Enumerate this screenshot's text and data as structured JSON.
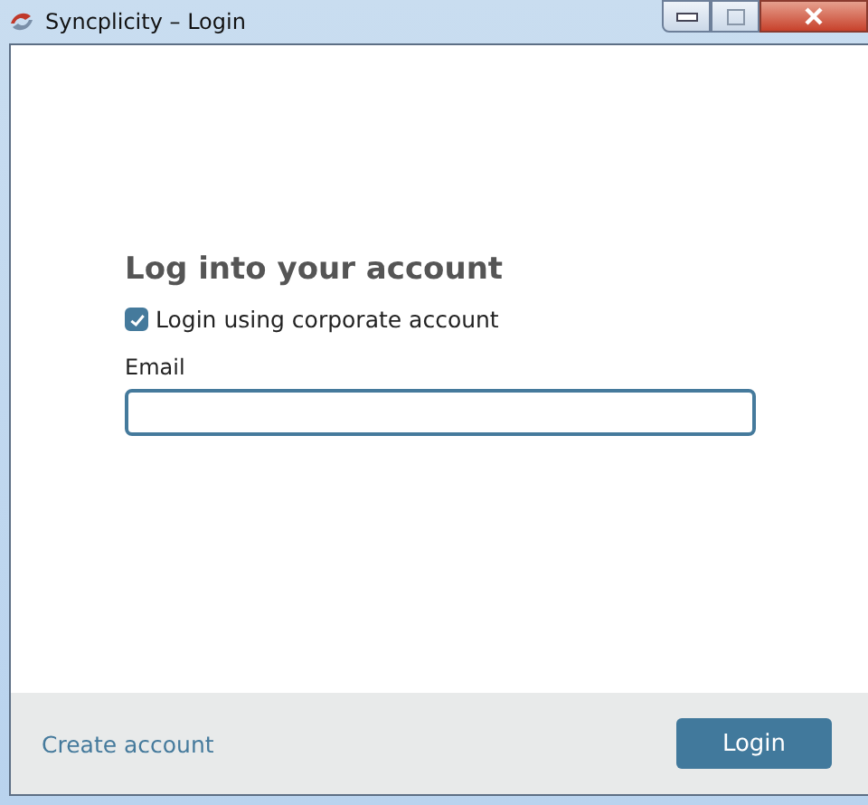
{
  "window": {
    "title": "Syncplicity – Login"
  },
  "heading": "Log into your account",
  "corporate_checkbox": {
    "label": "Login using corporate account",
    "checked": true
  },
  "email": {
    "label": "Email"
  },
  "footer": {
    "link": "Create account",
    "button": "Login"
  }
}
